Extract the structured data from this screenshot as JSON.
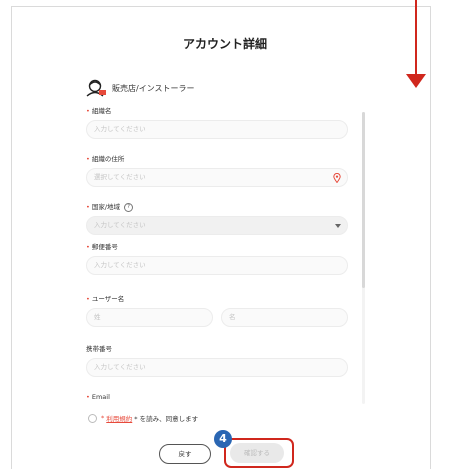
{
  "page": {
    "title": "アカウント詳細"
  },
  "role": {
    "label": "販売店/インストーラー",
    "icon": "installer-icon"
  },
  "fields": {
    "org_name": {
      "label": "組織名",
      "placeholder": "入力してください"
    },
    "org_address": {
      "label": "組織の住所",
      "placeholder": "選択してください"
    },
    "country": {
      "label": "国家/地域",
      "help": "?",
      "placeholder": "入力してください"
    },
    "postal": {
      "label": "郵便番号",
      "placeholder": "入力してください"
    },
    "username": {
      "label": "ユーザー名",
      "last_placeholder": "姓",
      "first_placeholder": "名"
    },
    "phone": {
      "label": "携帯番号",
      "placeholder": "入力してください"
    },
    "email": {
      "label": "Email"
    }
  },
  "agreement": {
    "prefix": "*",
    "terms": "利用規約",
    "suffix": "* を読み、同意します"
  },
  "buttons": {
    "back": "戻す",
    "confirm": "確認する"
  },
  "annotation": {
    "step_number": "4"
  },
  "colors": {
    "accent": "#d0271d",
    "required": "#e74a3b",
    "badge": "#2a66b3"
  }
}
